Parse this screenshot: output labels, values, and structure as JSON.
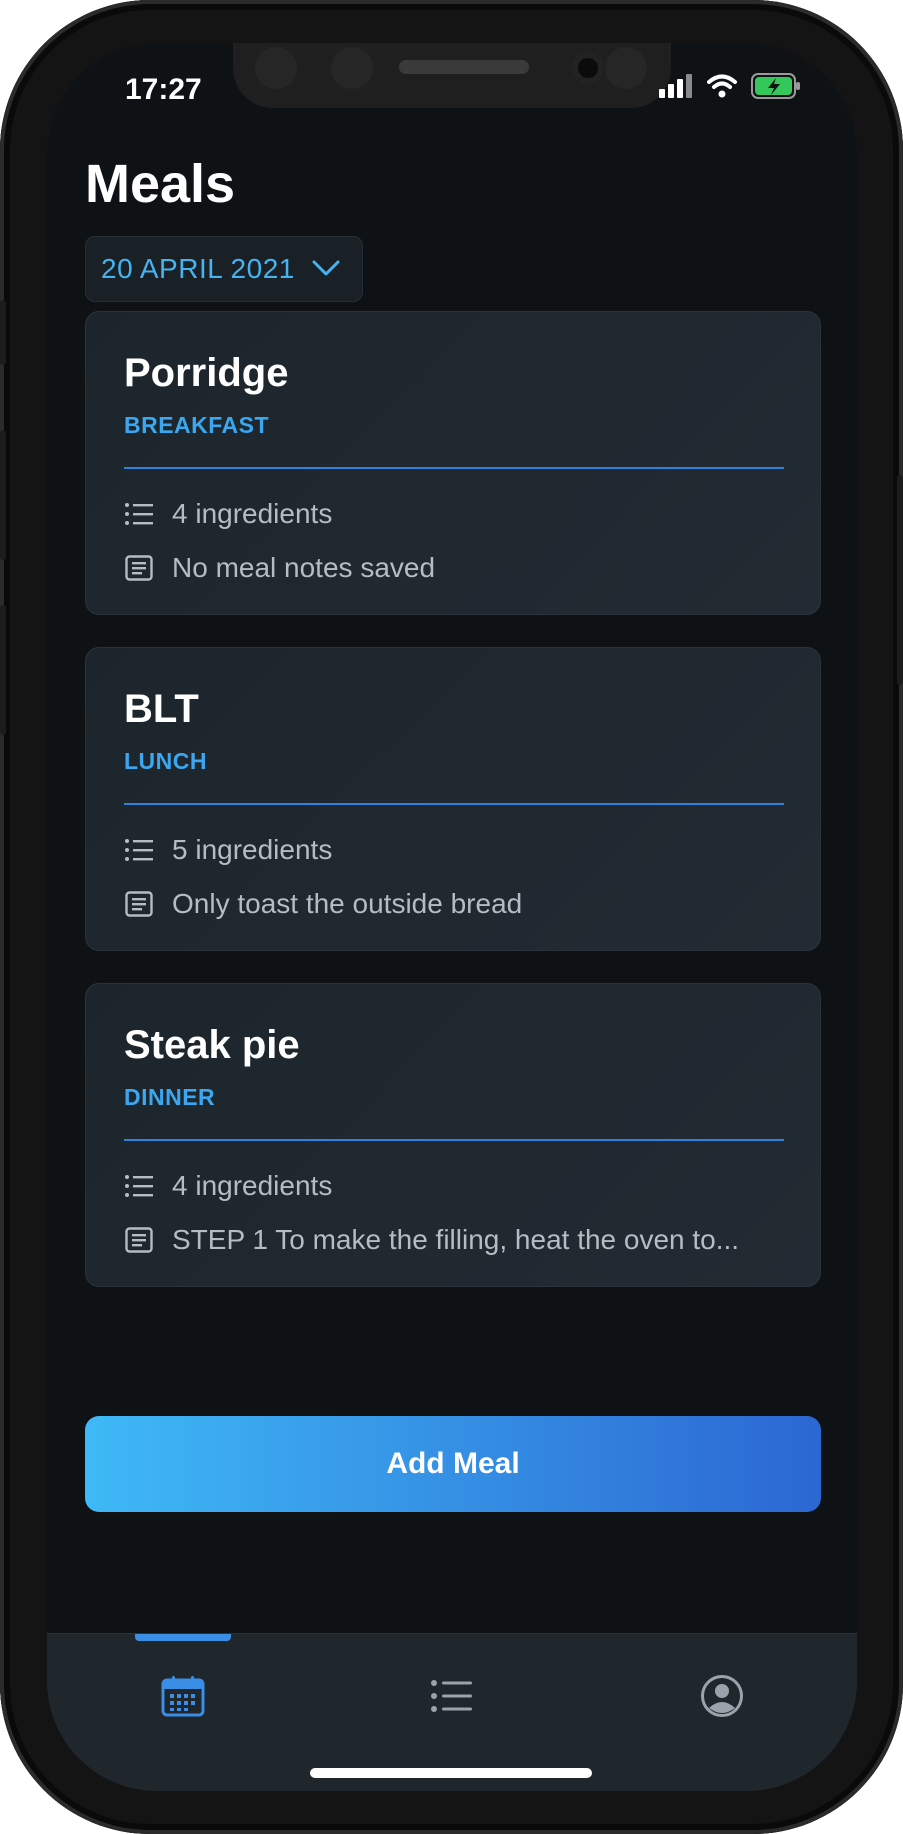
{
  "status_bar": {
    "time": "17:27"
  },
  "header": {
    "title": "Meals"
  },
  "date_selector": {
    "label": "20 APRIL 2021"
  },
  "meals": [
    {
      "name": "Porridge",
      "type": "BREAKFAST",
      "ingredients": "4 ingredients",
      "notes": "No meal notes saved"
    },
    {
      "name": "BLT",
      "type": "LUNCH",
      "ingredients": "5 ingredients",
      "notes": "Only toast the outside bread"
    },
    {
      "name": "Steak pie",
      "type": "DINNER",
      "ingredients": "4 ingredients",
      "notes": "STEP 1 To make the filling, heat the oven to..."
    }
  ],
  "add_button": {
    "label": "Add Meal"
  },
  "tab_bar": {
    "tabs": [
      {
        "icon": "calendar-icon",
        "active": true
      },
      {
        "icon": "list-icon",
        "active": false
      },
      {
        "icon": "profile-icon",
        "active": false
      }
    ]
  },
  "colors": {
    "accent": "#3aa7f0",
    "background": "#0f1214",
    "card": "#1f272e",
    "button_start": "#3fb9f7",
    "button_end": "#2b67d2"
  }
}
